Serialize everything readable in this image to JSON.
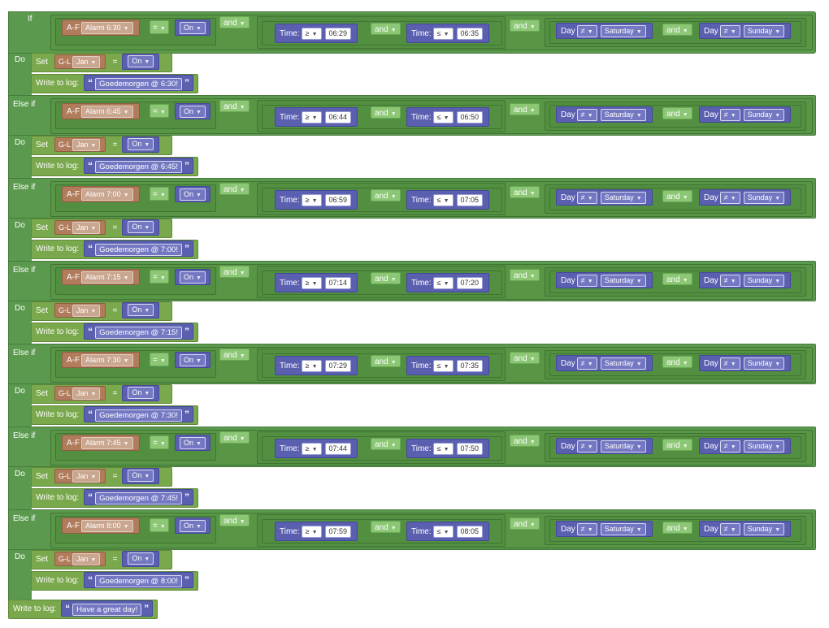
{
  "workspace": {
    "keywords": {
      "if": "If",
      "else_if": "Else if",
      "do": "Do",
      "and": "and",
      "set": "Set",
      "write_to_log": "Write to log:",
      "eq": "=",
      "ge": "≥",
      "le": "≤",
      "ne": "≠",
      "time": "Time:",
      "day": "Day",
      "quote_open": "“",
      "quote_close": "”"
    },
    "conditions": [
      {
        "item_prefix": "A-F",
        "item": "Alarm 6:30",
        "state": "On",
        "time_from": "06:29",
        "time_to": "06:35",
        "day1": "Saturday",
        "day2": "Sunday",
        "target_prefix": "G-L",
        "target": "Jan",
        "set_value": "On",
        "log": "Goedemorgen @ 6:30!"
      },
      {
        "item_prefix": "A-F",
        "item": "Alarm 6:45",
        "state": "On",
        "time_from": "06:44",
        "time_to": "06:50",
        "day1": "Saturday",
        "day2": "Sunday",
        "target_prefix": "G-L",
        "target": "Jan",
        "set_value": "On",
        "log": "Goedemorgen @ 6:45!"
      },
      {
        "item_prefix": "A-F",
        "item": "Alarm 7:00",
        "state": "On",
        "time_from": "06:59",
        "time_to": "07:05",
        "day1": "Saturday",
        "day2": "Sunday",
        "target_prefix": "G-L",
        "target": "Jan",
        "set_value": "On",
        "log": "Goedemorgen @ 7:00!"
      },
      {
        "item_prefix": "A-F",
        "item": "Alarm 7:15",
        "state": "On",
        "time_from": "07:14",
        "time_to": "07:20",
        "day1": "Saturday",
        "day2": "Sunday",
        "target_prefix": "G-L",
        "target": "Jan",
        "set_value": "On",
        "log": "Goedemorgen @ 7:15!"
      },
      {
        "item_prefix": "A-F",
        "item": "Alarm 7:30",
        "state": "On",
        "time_from": "07:29",
        "time_to": "07:35",
        "day1": "Saturday",
        "day2": "Sunday",
        "target_prefix": "G-L",
        "target": "Jan",
        "set_value": "On",
        "log": "Goedemorgen @ 7:30!"
      },
      {
        "item_prefix": "A-F",
        "item": "Alarm 7:45",
        "state": "On",
        "time_from": "07:44",
        "time_to": "07:50",
        "day1": "Saturday",
        "day2": "Sunday",
        "target_prefix": "G-L",
        "target": "Jan",
        "set_value": "On",
        "log": "Goedemorgen @ 7:45!"
      },
      {
        "item_prefix": "A-F",
        "item": "Alarm 8:00",
        "state": "On",
        "time_from": "07:59",
        "time_to": "08:05",
        "day1": "Saturday",
        "day2": "Sunday",
        "target_prefix": "G-L",
        "target": "Jan",
        "set_value": "On",
        "log": "Goedemorgen @ 8:00!"
      }
    ],
    "final_log": "Have a great day!",
    "colors": {
      "logic_green": "#5b9a4e",
      "item_brown": "#b07c5b",
      "value_blue": "#5a5fb0",
      "action_olive": "#7aa84c",
      "operator_lightgreen": "#8cc775",
      "settings_blue": "#3a63c9"
    },
    "icons": {
      "settings": "gear-icon",
      "dropdown": "dropdown-arrow-icon"
    }
  }
}
